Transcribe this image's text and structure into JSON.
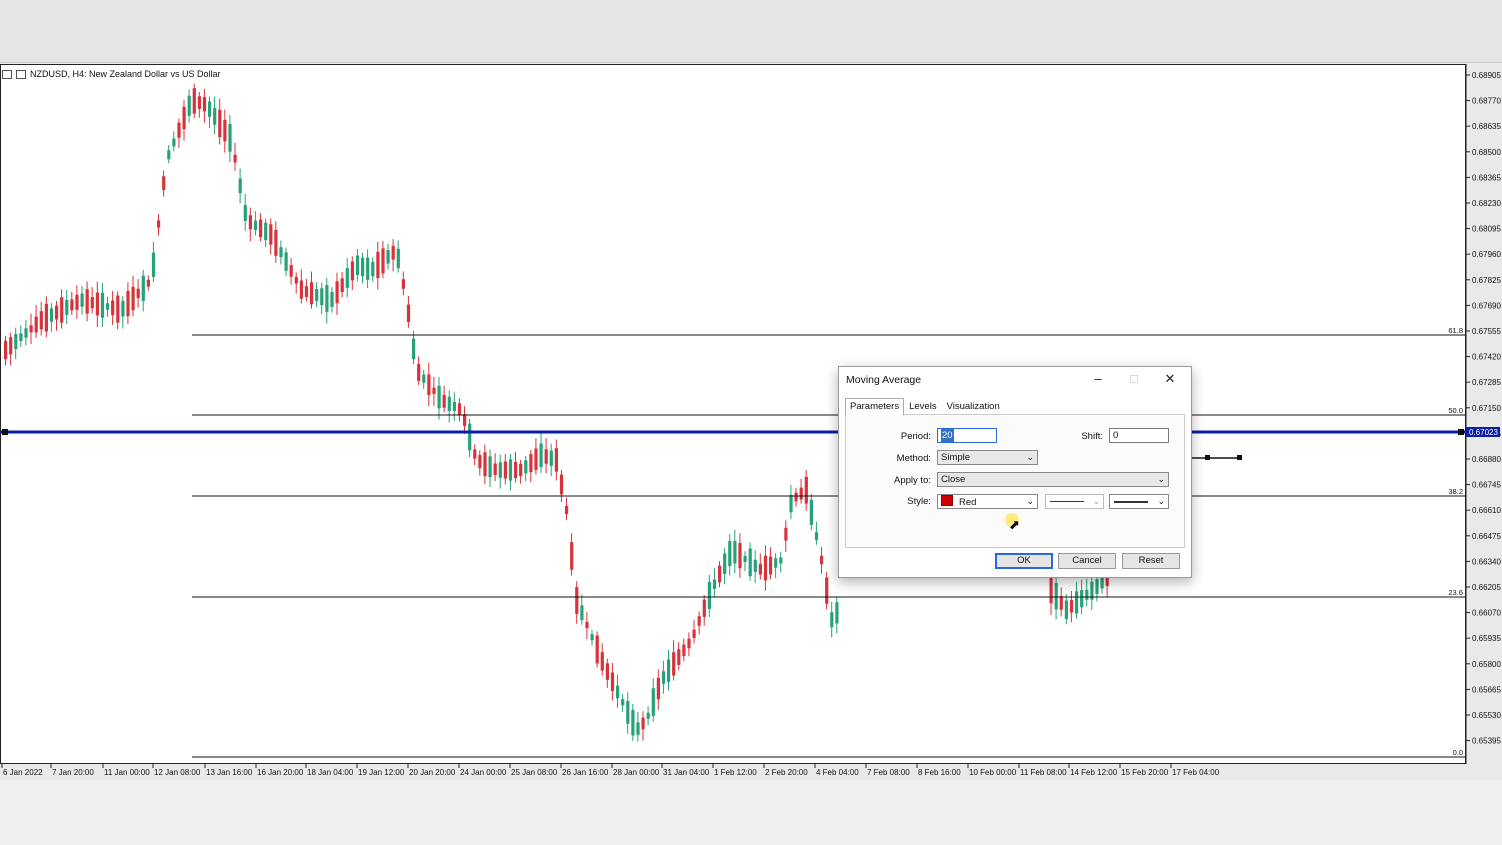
{
  "chart": {
    "title": "NZDUSD, H4:  New Zealand Dollar vs US Dollar",
    "price_labels": [
      "0.68905",
      "0.68770",
      "0.68635",
      "0.68500",
      "0.68365",
      "0.68230",
      "0.68095",
      "0.67960",
      "0.67825",
      "0.67690",
      "0.67555",
      "0.67420",
      "0.67285",
      "0.67150",
      "0.67015",
      "0.66880",
      "0.66745",
      "0.66610",
      "0.66475",
      "0.66340",
      "0.66205",
      "0.66070",
      "0.65935",
      "0.65800",
      "0.65665",
      "0.65530",
      "0.65395"
    ],
    "current_price": "0.67023",
    "time_labels": [
      "6 Jan 2022",
      "7 Jan 20:00",
      "11 Jan 00:00",
      "12 Jan 08:00",
      "13 Jan 16:00",
      "16 Jan 20:00",
      "18 Jan 04:00",
      "19 Jan 12:00",
      "20 Jan 20:00",
      "24 Jan 00:00",
      "25 Jan 08:00",
      "26 Jan 16:00",
      "28 Jan 00:00",
      "31 Jan 04:00",
      "1 Feb 12:00",
      "2 Feb 20:00",
      "4 Feb 04:00",
      "7 Feb 08:00",
      "8 Feb 16:00",
      "10 Feb 00:00",
      "11 Feb 08:00",
      "14 Feb 12:00",
      "15 Feb 20:00",
      "17 Feb 04:00"
    ],
    "fibo_levels": [
      "61.8",
      "50.0",
      "38.2",
      "23.6",
      "0.0"
    ],
    "colors": {
      "bull": "#26a17a",
      "bear": "#d8323a",
      "hline": "#0a1fa8",
      "fibo": "#111111"
    }
  },
  "dialog": {
    "title": "Moving Average",
    "tabs": [
      "Parameters",
      "Levels",
      "Visualization"
    ],
    "period_label": "Period:",
    "period_value": "20",
    "shift_label": "Shift:",
    "shift_value": "0",
    "method_label": "Method:",
    "method_value": "Simple",
    "apply_label": "Apply to:",
    "apply_value": "Close",
    "style_label": "Style:",
    "style_color": "Red",
    "style_color_hex": "#d00000",
    "ok": "OK",
    "cancel": "Cancel",
    "reset": "Reset"
  }
}
